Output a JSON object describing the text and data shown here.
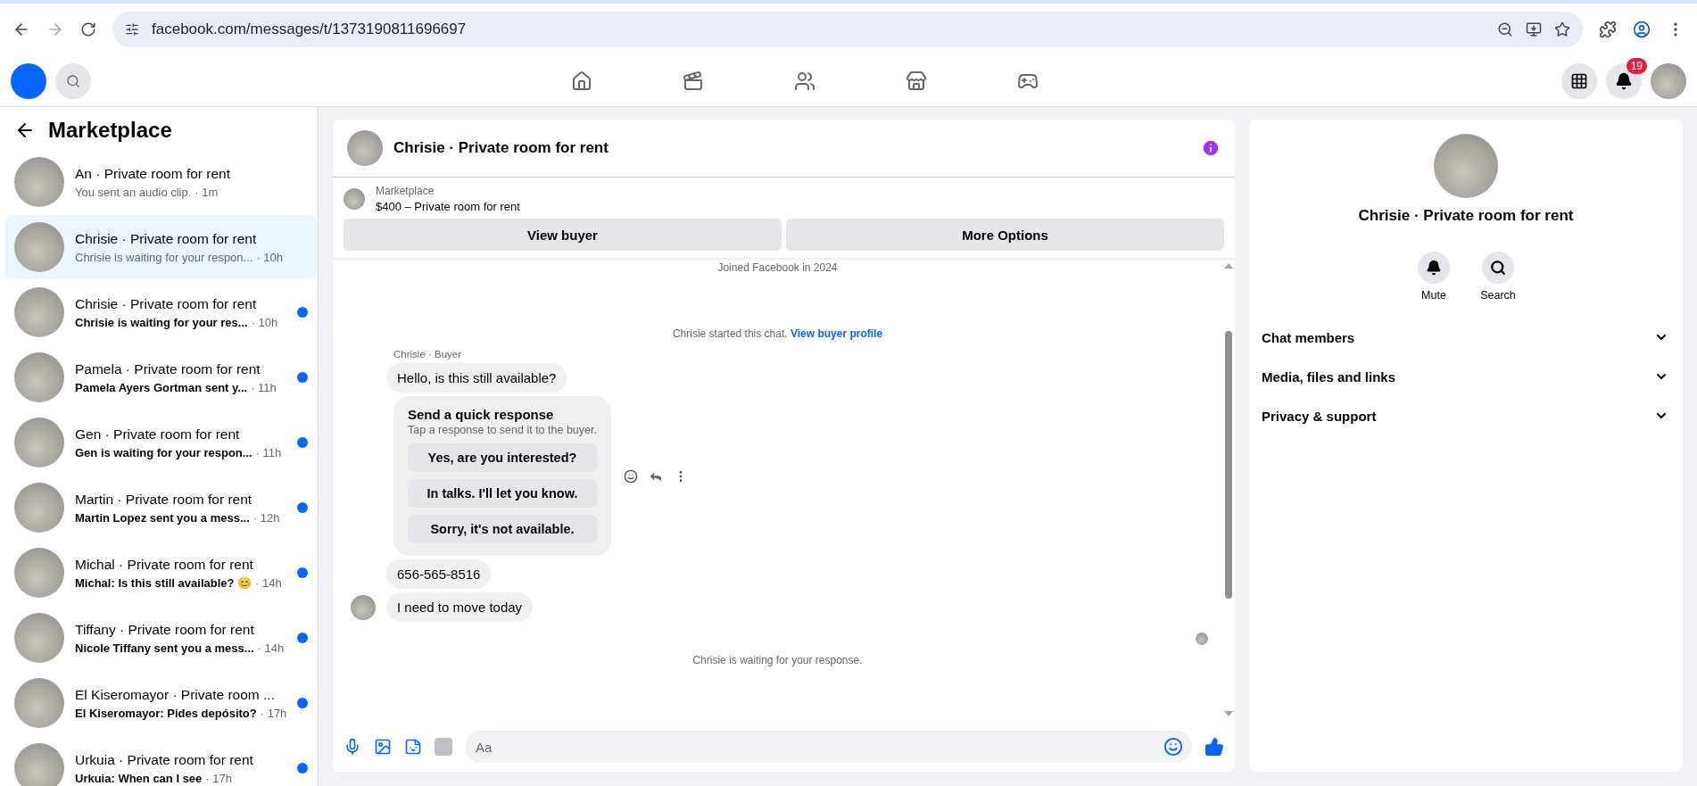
{
  "browser": {
    "url": "facebook.com/messages/t/1373190811696697"
  },
  "topbar": {
    "notification_count": "19"
  },
  "sidebar": {
    "title": "Marketplace",
    "conversations": [
      {
        "title": "An · Private room for rent",
        "preview": "You sent an audio clip.",
        "time": "· 1m",
        "unread": false,
        "selected": false
      },
      {
        "title": "Chrisie · Private room for rent",
        "preview": "Chrisie is waiting for your respon...",
        "time": "· 10h",
        "unread": false,
        "selected": true
      },
      {
        "title": "Chrisie · Private room for rent",
        "preview": "Chrisie is waiting for your res...",
        "time": "· 10h",
        "unread": true,
        "selected": false
      },
      {
        "title": "Pamela · Private room for rent",
        "preview": "Pamela Ayers Gortman sent y...",
        "time": "· 11h",
        "unread": true,
        "selected": false
      },
      {
        "title": "Gen · Private room for rent",
        "preview": "Gen is waiting for your respon...",
        "time": "· 11h",
        "unread": true,
        "selected": false
      },
      {
        "title": "Martin · Private room for rent",
        "preview": "Martin Lopez sent you a mess...",
        "time": "· 12h",
        "unread": true,
        "selected": false
      },
      {
        "title": "Michal · Private room for rent",
        "preview": "Michal: Is this still available? 😊",
        "time": "· 14h",
        "unread": true,
        "selected": false
      },
      {
        "title": "Tiffany · Private room for rent",
        "preview": "Nicole Tiffany sent you a mess...",
        "time": "· 14h",
        "unread": true,
        "selected": false
      },
      {
        "title": "El Kiseromayor · Private room ...",
        "preview": "El Kiseromayor: Pides depósito?",
        "time": "· 17h",
        "unread": true,
        "selected": false
      },
      {
        "title": "Urkuia · Private room for rent",
        "preview": "Urkuia: When can I see",
        "time": "· 17h",
        "unread": true,
        "selected": false
      }
    ]
  },
  "chat": {
    "title": "Chrisie · Private room for rent",
    "listing": {
      "label": "Marketplace",
      "item": "$400 – Private room for rent"
    },
    "buttons": [
      "View buyer",
      "More Options"
    ],
    "messages": [
      {
        "kind": "notice",
        "text": "Joined Facebook in 2024"
      },
      {
        "kind": "notice",
        "text": "Chrisie started this chat.",
        "link": "View buyer profile"
      },
      {
        "kind": "sender",
        "text": "Chrisie · Buyer"
      },
      {
        "kind": "bubble",
        "text": "Hello, is this still available?",
        "avatar": false
      },
      {
        "kind": "quick",
        "title": "Send a quick response",
        "subtitle": "Tap a response to send it to the buyer.",
        "options": [
          "Yes, are you interested?",
          "In talks. I'll let you know.",
          "Sorry, it's not available."
        ]
      },
      {
        "kind": "bubble",
        "text": "656-565-8516",
        "avatar": false
      },
      {
        "kind": "bubble",
        "text": "I need to move today",
        "avatar": true
      },
      {
        "kind": "seen"
      },
      {
        "kind": "notice",
        "text": "Chrisie is waiting for your response."
      }
    ],
    "composer": {
      "placeholder": "Aa"
    }
  },
  "details": {
    "title": "Chrisie · Private room for rent",
    "actions": [
      {
        "kind": "bell",
        "label": "Mute"
      },
      {
        "kind": "search",
        "label": "Search"
      }
    ],
    "sections": [
      "Chat members",
      "Media, files and links",
      "Privacy & support"
    ]
  }
}
